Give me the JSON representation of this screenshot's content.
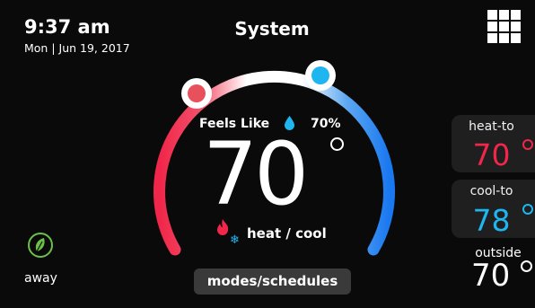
{
  "header": {
    "time": "9:37 am",
    "date": "Mon | Jun 19, 2017",
    "title": "System",
    "menu_icon": "grid-menu-icon"
  },
  "dial": {
    "feels_like_label": "Feels Like",
    "humidity": "70%",
    "current_temp": "70",
    "mode_label": "heat / cool",
    "heat_handle_color": "#e8505b",
    "cool_handle_color": "#1fb6f0"
  },
  "modes_button": {
    "label": "modes/schedules"
  },
  "heat_to": {
    "label": "heat-to",
    "value": "70",
    "color": "#f0264a"
  },
  "cool_to": {
    "label": "cool-to",
    "value": "78",
    "color": "#1fb6f0"
  },
  "outside": {
    "label": "outside",
    "value": "70"
  },
  "away": {
    "label": "away",
    "icon": "leaf-icon"
  }
}
